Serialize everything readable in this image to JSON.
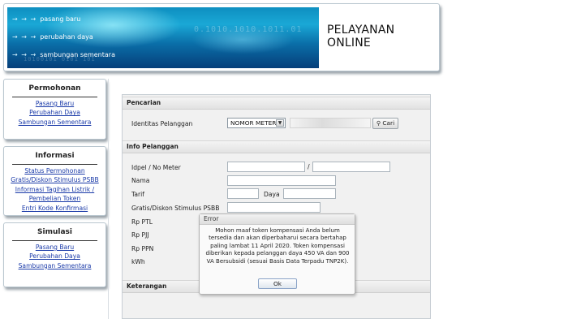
{
  "header": {
    "banner_links": [
      "pasang baru",
      "perubahan daya",
      "sambungan sementara"
    ],
    "title_line1": "PELAYANAN",
    "title_line2": "ONLINE"
  },
  "permohonan": {
    "title": "Permohonan",
    "links": [
      "Pasang Baru",
      "Perubahan Daya",
      "Sambungan Sementara"
    ]
  },
  "informasi": {
    "title": "Informasi",
    "links": [
      "Status Permohonan",
      "Gratis/Diskon Stimulus PSBB",
      "Informasi Tagihan Listrik /",
      "Pembelian Token",
      "Entri Kode Konfirmasi"
    ]
  },
  "simulasi": {
    "title": "Simulasi",
    "links": [
      "Pasang Baru",
      "Perubahan Daya",
      "Sambungan Sementara"
    ]
  },
  "pencarian": {
    "heading": "Pencarian",
    "label": "Identitas Pelanggan",
    "select_value": "NOMOR METER",
    "search_button": "Cari"
  },
  "info": {
    "heading": "Info Pelanggan",
    "labels": [
      "Idpel / No Meter",
      "Nama",
      "Tarif",
      "Gratis/Diskon Stimulus PSBB",
      "Rp PTL",
      "Rp PJJ",
      "Rp PPN",
      "kWh"
    ],
    "slash": "/",
    "daya_label": "Daya"
  },
  "keterangan": {
    "heading": "Keterangan"
  },
  "dialog": {
    "title": "Error",
    "message": "Mohon maaf token kompensasi Anda belum tersedia dan akan diperbaharui secara bertahap paling lambat 11 April 2020. Token kompensasi diberikan kepada pelanggan daya 450 VA dan 900 VA Bersubsidi (sesuai Basis Data Terpadu TNP2K).",
    "ok_label": "Ok"
  }
}
